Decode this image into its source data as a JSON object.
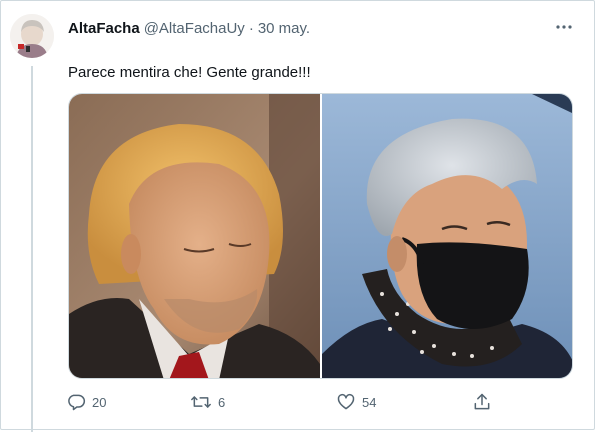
{
  "tweet": {
    "author": {
      "display_name": "AltaFacha",
      "handle": "@AltaFachaUy",
      "avatar_icon": "avatar"
    },
    "separator": "·",
    "date": "30 may.",
    "text": "Parece mentira che! Gente grande!!!",
    "media": [
      {
        "icon": "photo",
        "subject": "older man with orange-tinted hair, looking down, dark suit and red tie"
      },
      {
        "icon": "photo",
        "subject": "man with grey hair wearing black face mask and dotted scarf"
      }
    ],
    "actions": {
      "reply": {
        "icon": "reply-icon",
        "count": "20"
      },
      "retweet": {
        "icon": "retweet-icon",
        "count": "6"
      },
      "like": {
        "icon": "heart-icon",
        "count": "54"
      },
      "share": {
        "icon": "share-icon"
      }
    },
    "more_icon": "more-icon"
  },
  "colors": {
    "text_primary": "#0f1419",
    "text_secondary": "#536471",
    "border": "#cfd9de",
    "background": "#ffffff"
  }
}
